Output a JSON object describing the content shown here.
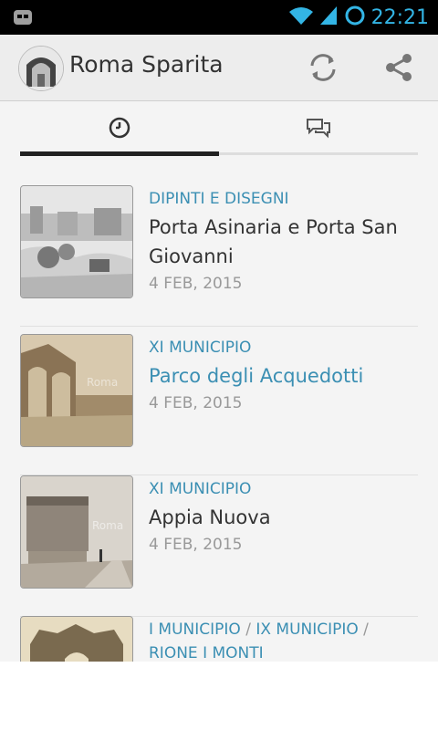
{
  "status_bar": {
    "time": "22:21"
  },
  "app": {
    "title": "Roma Sparita"
  },
  "tabs": [
    {
      "icon": "clock-icon"
    },
    {
      "icon": "comments-icon"
    }
  ],
  "articles": [
    {
      "category": "DIPINTI E DISEGNI",
      "title": "Porta Asinaria e Porta San Giovanni",
      "date": "4 FEB, 2015"
    },
    {
      "category": "XI MUNICIPIO",
      "title": "Parco degli Acquedotti",
      "date": "4 FEB, 2015"
    },
    {
      "category": "XI MUNICIPIO",
      "title": "Appia Nuova",
      "date": "4 FEB, 2015"
    },
    {
      "categories": [
        "I MUNICIPIO",
        "IX MUNICIPIO",
        "RIONE I MONTI"
      ],
      "separator": " / "
    }
  ],
  "watermark": "Roma",
  "colors": {
    "accent": "#3b8fb3",
    "statusbar_icon": "#33b5e5"
  }
}
